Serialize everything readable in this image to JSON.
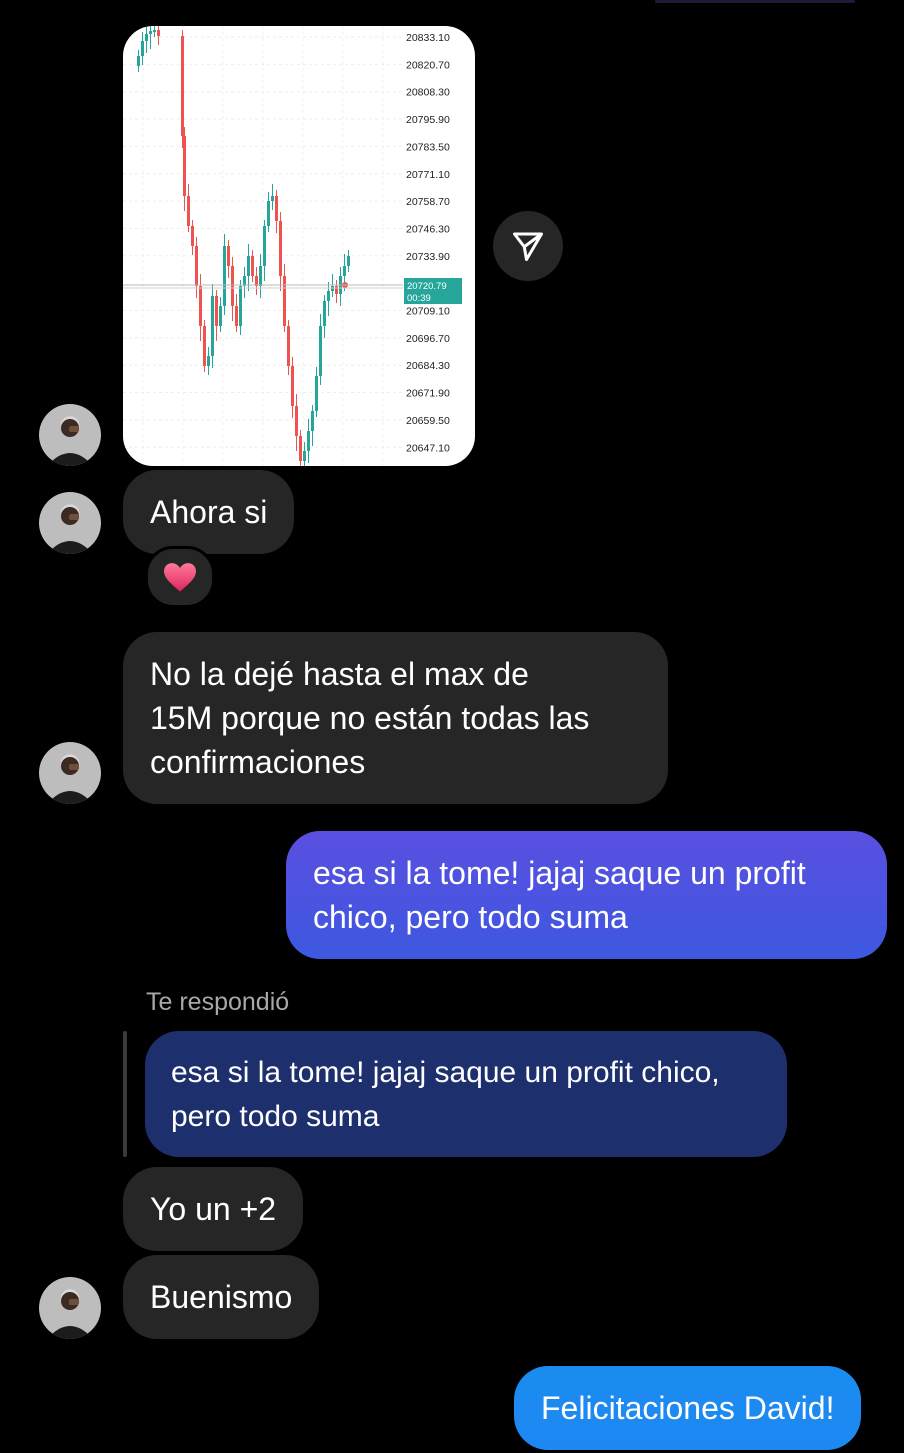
{
  "chart": {
    "price_ticks": [
      "20833.10",
      "20820.70",
      "20808.30",
      "20795.90",
      "20783.50",
      "20771.10",
      "20758.70",
      "20746.30",
      "20733.90",
      "20709.10",
      "20696.70",
      "20684.30",
      "20671.90",
      "20659.50",
      "20647.10"
    ],
    "current_price": "20720.79",
    "countdown": "00:39",
    "colors": {
      "up": "#26a69a",
      "down": "#ef5350",
      "current_tag": "#26a69a"
    }
  },
  "messages": [
    {
      "id": "m1",
      "sender": "other",
      "text": "Ahora si",
      "reaction": "heart-emoji"
    },
    {
      "id": "m2",
      "sender": "other",
      "lines": [
        "No la dejé hasta el max de",
        "15M porque no están todas las",
        "confirmaciones"
      ]
    },
    {
      "id": "m3",
      "sender": "me",
      "lines": [
        "esa si la tome! jajaj saque un profit",
        "chico, pero todo suma"
      ]
    },
    {
      "id": "m4",
      "sender": "other",
      "reply_label": "Te respondió",
      "quoted_lines": [
        "esa si la tome! jajaj saque un profit chico,",
        "pero todo suma"
      ]
    },
    {
      "id": "m5",
      "sender": "other",
      "text": "Yo un +2"
    },
    {
      "id": "m6",
      "sender": "other",
      "text": "Buenismo"
    },
    {
      "id": "m7",
      "sender": "me",
      "text": "Felicitaciones David!"
    }
  ],
  "colors": {
    "background": "#000000",
    "incoming_bubble": "#262626",
    "outgoing_gradient_top": "#5a4fe0",
    "outgoing_gradient_bottom": "#1f8ef1",
    "quoted_bubble": "#1e2f6e"
  },
  "icons": {
    "share": "paper-plane-icon",
    "avatar": "contact-avatar"
  }
}
